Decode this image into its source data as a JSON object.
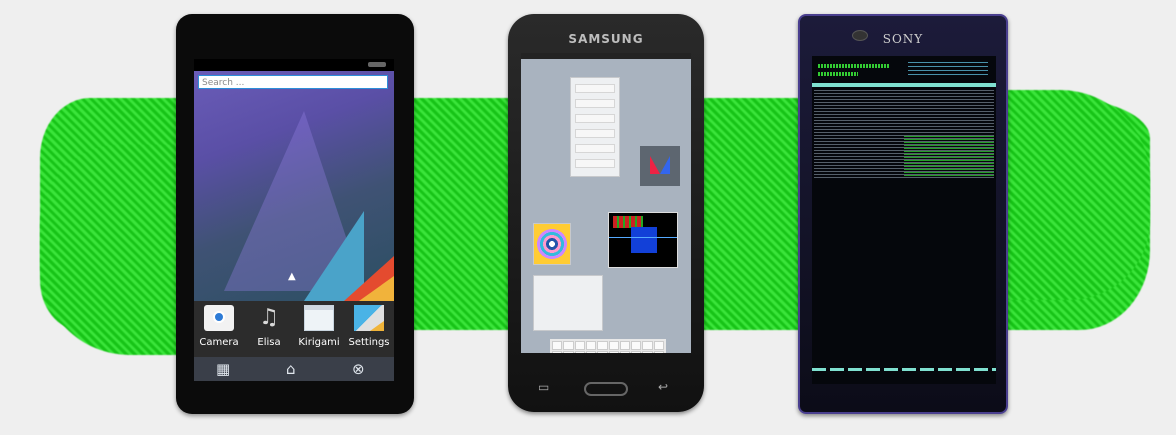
{
  "phone1": {
    "search_placeholder": "Search ...",
    "dock_apps": [
      {
        "label": "Camera",
        "icon": "camera-icon"
      },
      {
        "label": "Elisa",
        "icon": "music-note-icon"
      },
      {
        "label": "Kirigami",
        "icon": "window-icon"
      },
      {
        "label": "Settings",
        "icon": "settings-icon"
      }
    ],
    "nav_icons": [
      "app-grid-icon",
      "home-icon",
      "close-icon"
    ],
    "nav_glyphs": {
      "grid": "▦",
      "home": "⌂",
      "close": "⊗"
    },
    "up_arrow": "▲"
  },
  "phone2": {
    "brand": "SAMSUNG",
    "nav_glyphs": {
      "recent": "▭",
      "back": "↩"
    }
  },
  "phone3": {
    "brand": "SONY"
  },
  "colors": {
    "brush_green": "#2ed42e",
    "background": "#efefef"
  }
}
